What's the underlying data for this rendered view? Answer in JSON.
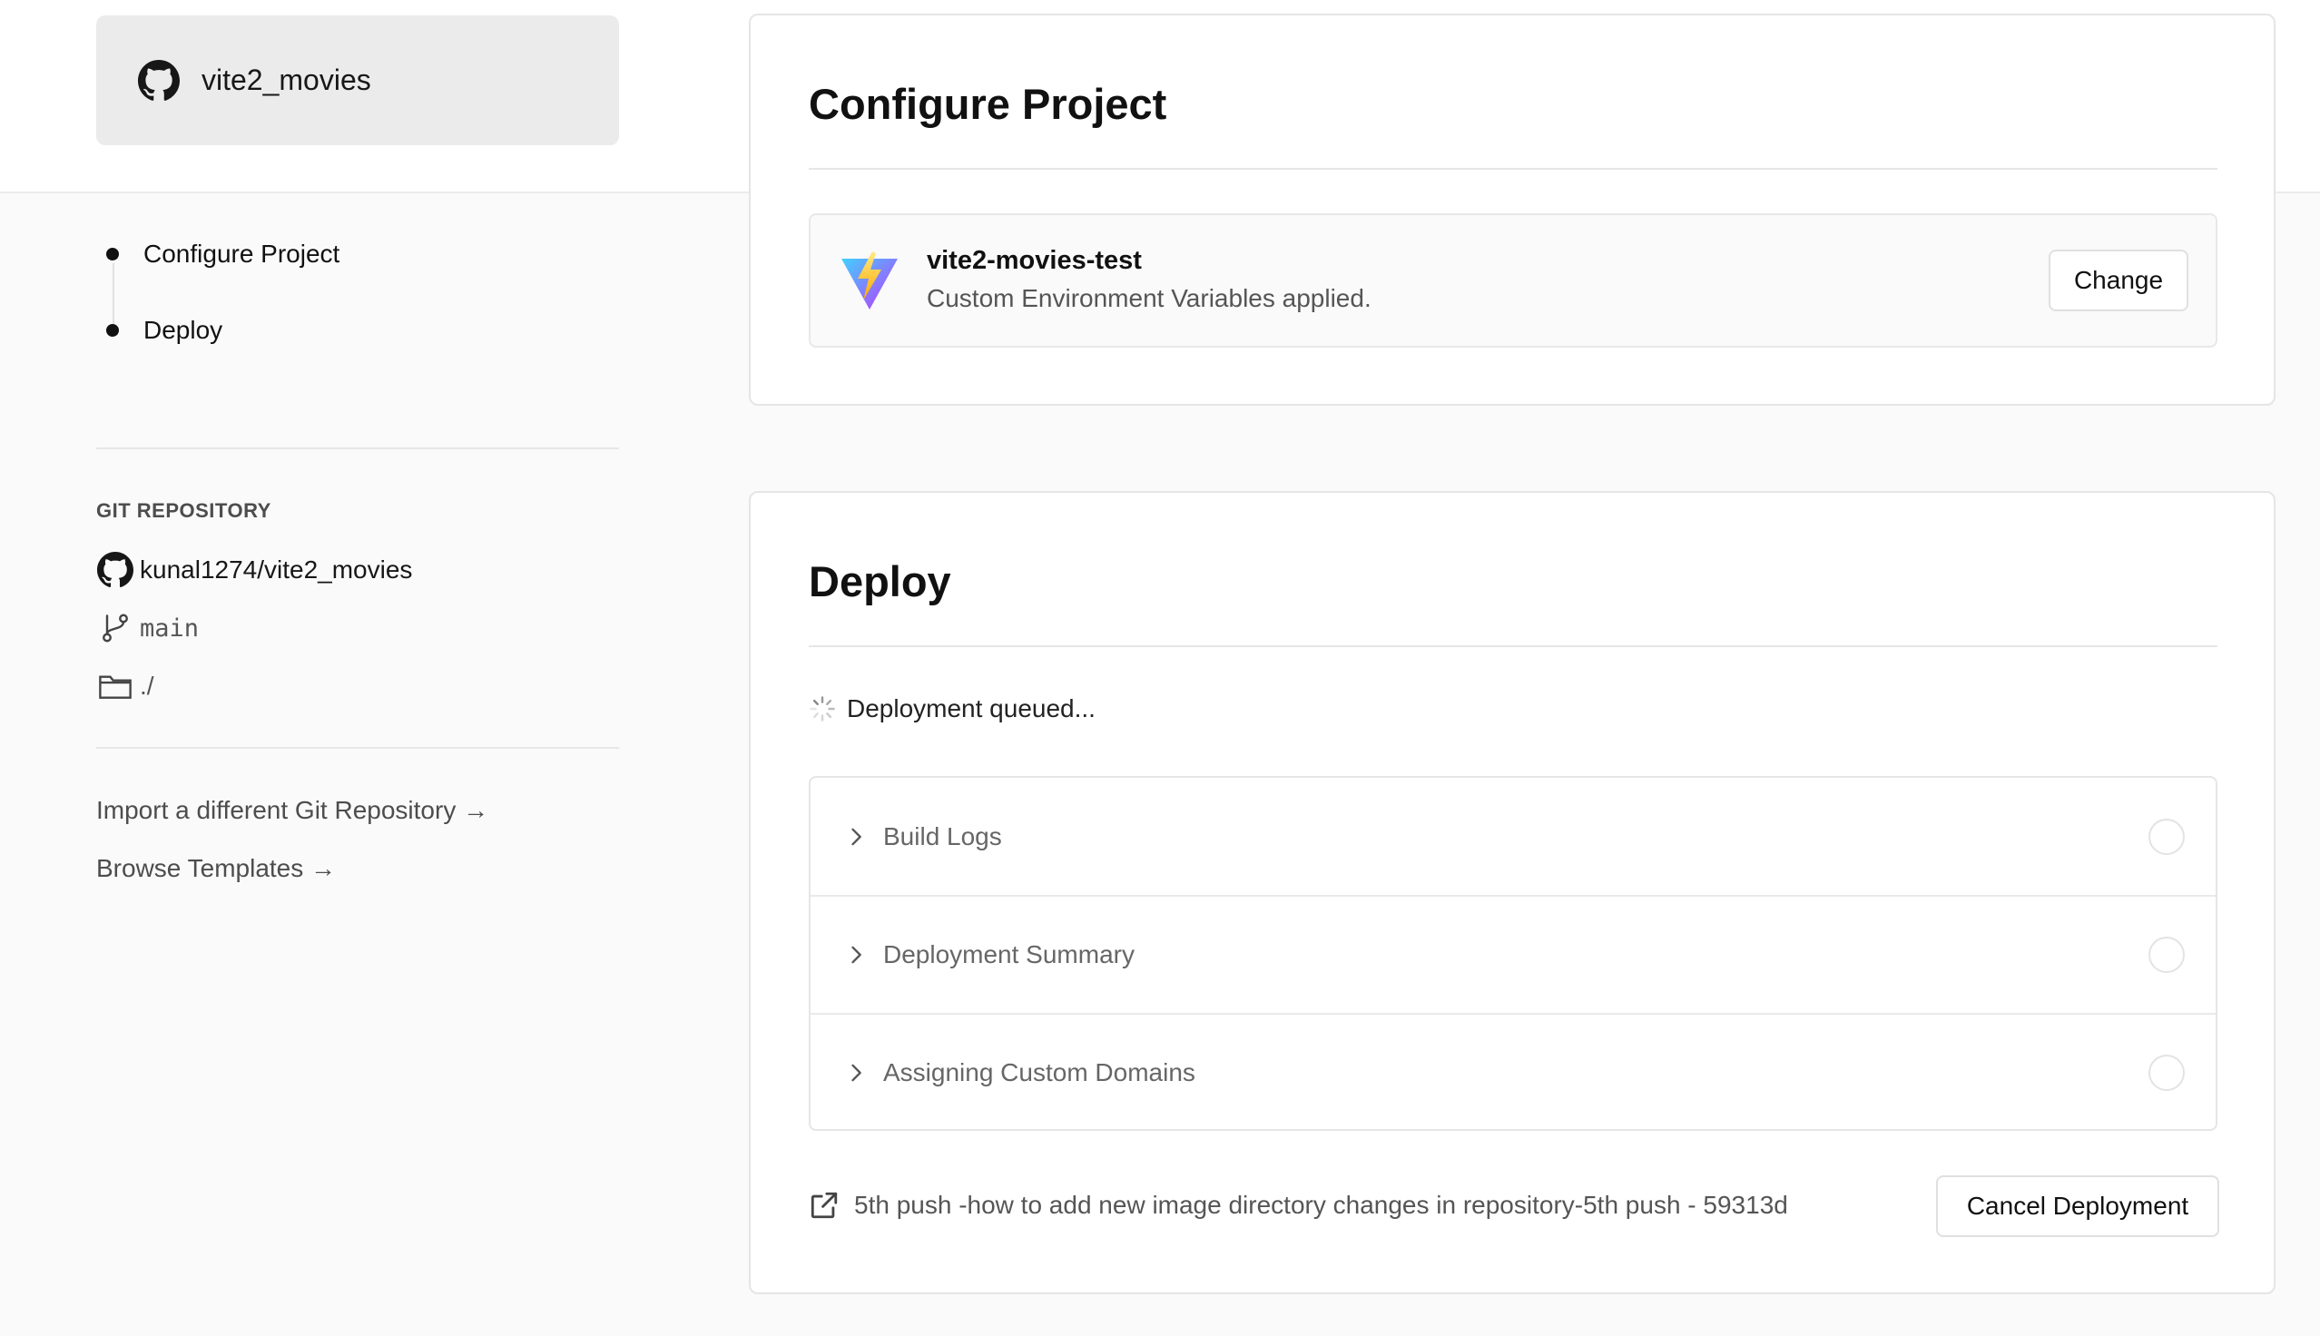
{
  "project_card": {
    "repo_name": "vite2_movies",
    "icon": "github-icon"
  },
  "steps": [
    {
      "label": "Configure Project"
    },
    {
      "label": "Deploy"
    }
  ],
  "git": {
    "heading": "GIT REPOSITORY",
    "repo": "kunal1274/vite2_movies",
    "branch": "main",
    "directory": "./"
  },
  "links": {
    "import": "Import a different Git Repository →",
    "templates": "Browse Templates →"
  },
  "configure": {
    "title": "Configure Project",
    "project_name": "vite2-movies-test",
    "project_sub": "Custom Environment Variables applied.",
    "change_label": "Change"
  },
  "deploy": {
    "title": "Deploy",
    "status": "Deployment queued...",
    "sections": [
      {
        "label": "Build Logs"
      },
      {
        "label": "Deployment Summary"
      },
      {
        "label": "Assigning Custom Domains"
      }
    ],
    "commit": "5th push -how to add new image directory changes in repository-5th push - 59313d",
    "cancel_label": "Cancel Deployment"
  }
}
